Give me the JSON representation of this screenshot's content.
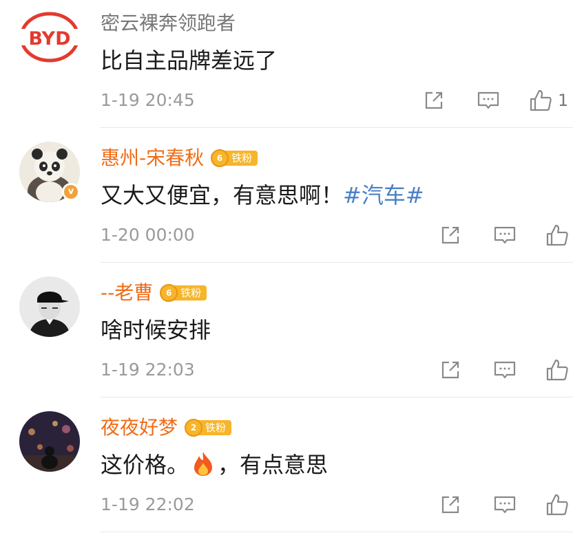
{
  "comments": [
    {
      "username": "密云裸奔领跑者",
      "fan_badge": null,
      "text": "比自主品牌差远了",
      "topic": "",
      "time": "1-19 20:45",
      "like_count": "1",
      "avatar_logo_text": "BYD",
      "avatar_icon": "byd-logo",
      "accent_color": "#e33a2f"
    },
    {
      "username": "惠州-宋春秋",
      "fan_badge": {
        "level": "6",
        "label": "铁粉"
      },
      "verified_icon": "v",
      "text": "又大又便宜，有意思啊！",
      "topic": "#汽车#",
      "time": "1-20 00:00",
      "like_count": "",
      "avatar_icon": "panda-avatar"
    },
    {
      "username": "--老曹",
      "fan_badge": {
        "level": "6",
        "label": "铁粉"
      },
      "text": "啥时候安排",
      "topic": "",
      "time": "1-19 22:03",
      "like_count": "",
      "avatar_icon": "person-cap-avatar"
    },
    {
      "username": "夜夜好梦",
      "fan_badge": {
        "level": "2",
        "label": "铁粉"
      },
      "text_before": "这价格。",
      "text_after": "，有点意思",
      "emoji_icon": "fire-emoji",
      "time": "1-19 22:02",
      "like_count": "",
      "avatar_icon": "night-city-avatar"
    }
  ],
  "colors": {
    "username_vip": "#f06b16",
    "username_plain": "#777777",
    "topic": "#4a7fc7",
    "fan_badge": "#f7b52b",
    "meta": "#9a9a9a"
  },
  "action_icons": [
    "share-icon",
    "comment-icon",
    "like-icon"
  ]
}
